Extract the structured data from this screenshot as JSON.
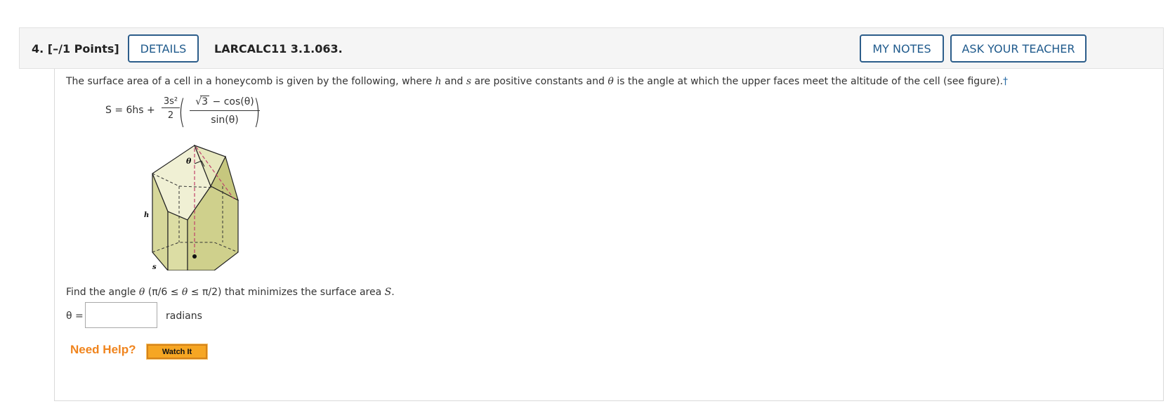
{
  "header": {
    "question_number": "4.",
    "points": "[–/1 Points]",
    "details_label": "DETAILS",
    "reference": "LARCALC11 3.1.063.",
    "my_notes_label": "MY NOTES",
    "ask_teacher_label": "ASK YOUR TEACHER"
  },
  "prompt": {
    "part1": "The surface area of a cell in a honeycomb is given by the following, where ",
    "var_h": "h",
    "part2": " and ",
    "var_s": "s",
    "part3": " are positive constants and ",
    "var_theta": "θ",
    "part4": " is the angle at which the upper faces meet the altitude of the cell (see figure).",
    "dagger": "†"
  },
  "formula": {
    "lhs": "S = 6hs +",
    "frac1_num": "3s²",
    "frac1_den": "2",
    "frac2_num_sqrt": "3",
    "frac2_num_rest": " − cos(θ)",
    "frac2_den": "sin(θ)"
  },
  "figure": {
    "label_theta": "θ",
    "label_h": "h",
    "label_s": "s",
    "face_color": "#d6d79a",
    "top_color": "#f0f0d4"
  },
  "task": {
    "part1": "Find the angle ",
    "theta": "θ",
    "part2": " (π/6 ≤ ",
    "part3": " ≤ π/2) that minimizes the surface area ",
    "var_S": "S",
    "part4": "."
  },
  "answer": {
    "label": "θ =",
    "value": "",
    "unit": "radians"
  },
  "help": {
    "label": "Need Help?",
    "watch_label": "Watch It"
  },
  "colors": {
    "accent": "#1f5a8c",
    "help_orange": "#f0841d",
    "watch_button": "#f6a623"
  }
}
